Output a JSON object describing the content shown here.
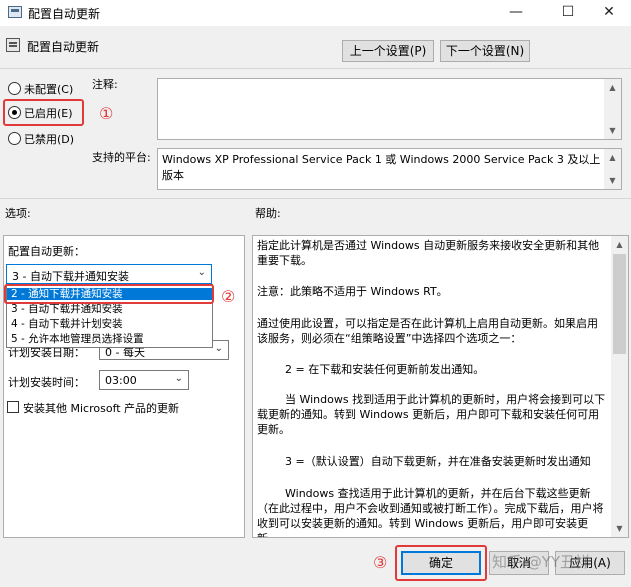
{
  "window": {
    "title": "配置自动更新",
    "minimize": "—",
    "maximize": "☐",
    "close": "✕"
  },
  "header": {
    "title": "配置自动更新",
    "prev_button": "上一个设置(P)",
    "next_button": "下一个设置(N)"
  },
  "state": {
    "not_configured": "未配置(C)",
    "enabled": "已启用(E)",
    "disabled": "已禁用(D)",
    "selected": "enabled"
  },
  "comment": {
    "label": "注释:",
    "value": ""
  },
  "platform": {
    "label": "支持的平台:",
    "value": "Windows XP Professional Service Pack 1 或 Windows 2000 Service Pack 3 及以上版本"
  },
  "options": {
    "label": "选项:",
    "configure_label": "配置自动更新：",
    "combo_value": "3 - 自动下载并通知安装",
    "dropdown_items": [
      "2 - 通知下载并通知安装",
      "3 - 自动下载并通知安装",
      "4 - 自动下载并计划安装",
      "5 - 允许本地管理员选择设置"
    ],
    "schedule_day_label": "计划安装日期：",
    "schedule_day_value": "0 - 每天",
    "schedule_time_label": "计划安装时间：",
    "schedule_time_value": "03:00",
    "install_other_label": "安装其他 Microsoft 产品的更新"
  },
  "help": {
    "label": "帮助:",
    "paragraphs": [
      "指定此计算机是否通过 Windows 自动更新服务来接收安全更新和其他重要下载。",
      "注意：此策略不适用于 Windows RT。",
      "通过使用此设置，可以指定是否在此计算机上启用自动更新。如果启用该服务，则必须在“组策略设置”中选择四个选项之一：",
      "2 = 在下载和安装任何更新前发出通知。",
      "当 Windows 找到适用于此计算机的更新时，用户将会接到可以下载更新的通知。转到 Windows 更新后，用户即可下载和安装任何可用更新。",
      "3 =（默认设置）自动下载更新，并在准备安装更新时发出通知",
      "Windows 查找适用于此计算机的更新，并在后台下载这些更新（在此过程中，用户不会收到通知或被打断工作）。完成下载后，用户将收到可以安装更新的通知。转到 Windows 更新后，用户即可安装更新。"
    ]
  },
  "footer": {
    "ok_button": "确定",
    "cancel_button": "取消",
    "apply_button": "应用(A)"
  },
  "annotations": {
    "one": "①",
    "two": "②",
    "three": "③"
  },
  "watermark": "知乎 @YY丑祥",
  "colors": {
    "accent": "#0078d7",
    "annotation_red": "#e03a3a",
    "window_bg": "#f0f0f0"
  }
}
